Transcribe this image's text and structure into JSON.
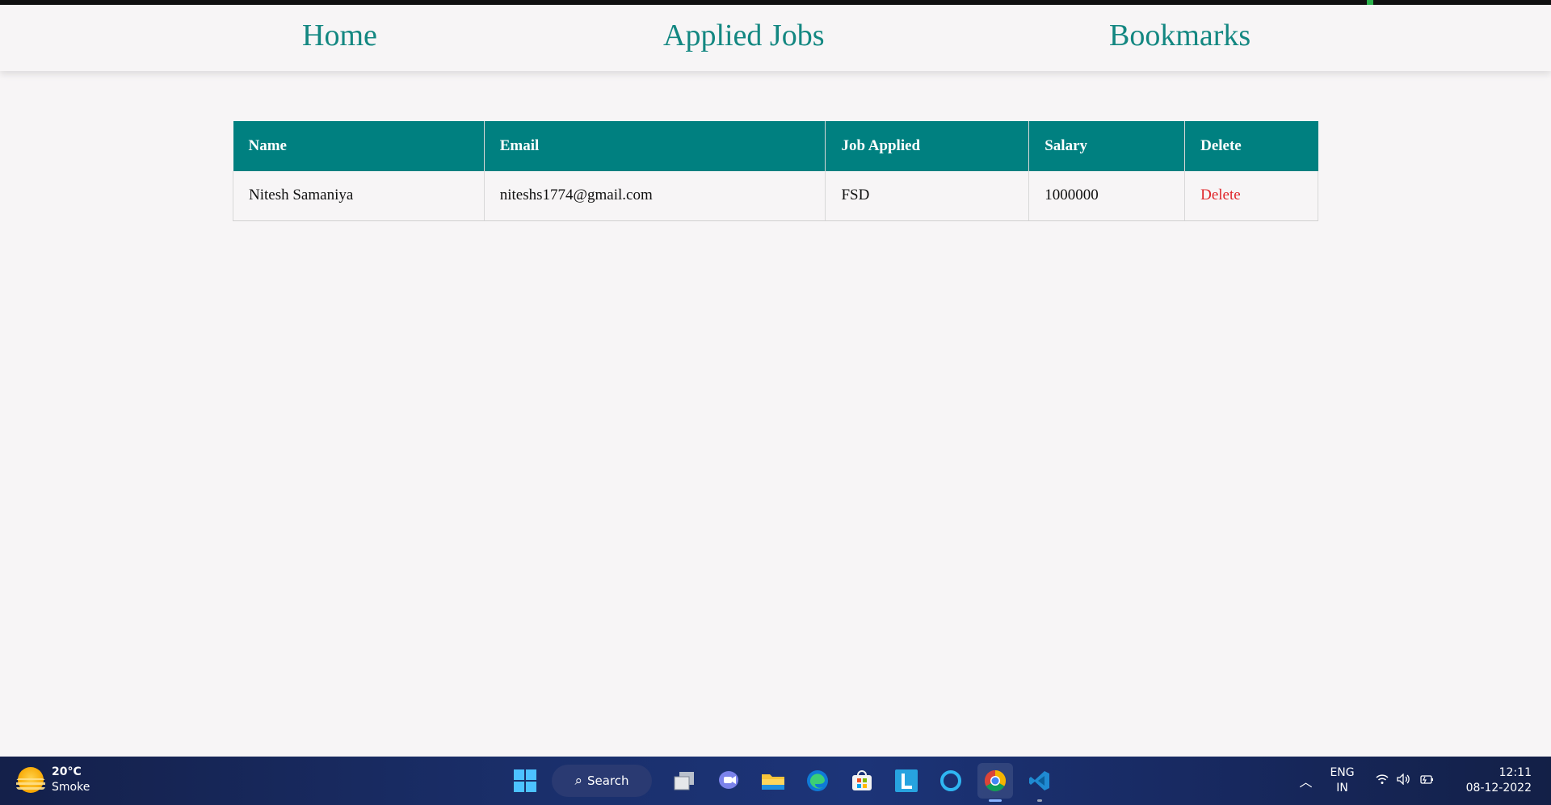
{
  "nav": {
    "home": "Home",
    "applied_jobs": "Applied Jobs",
    "bookmarks": "Bookmarks"
  },
  "table": {
    "headers": [
      "Name",
      "Email",
      "Job Applied",
      "Salary",
      "Delete"
    ],
    "rows": [
      {
        "name": "Nitesh Samaniya",
        "email": "niteshs1774@gmail.com",
        "job": "FSD",
        "salary": "1000000",
        "delete": "Delete"
      }
    ]
  },
  "colors": {
    "accent": "#008080",
    "nav_link": "#138781",
    "delete": "#e0262b"
  },
  "taskbar": {
    "weather_temp": "20°C",
    "weather_desc": "Smoke",
    "search_label": "Search",
    "lang_line1": "ENG",
    "lang_line2": "IN",
    "time": "12:11",
    "date": "08-12-2022",
    "icons": [
      "windows-start-icon",
      "search-icon",
      "task-view-icon",
      "teams-chat-icon",
      "file-explorer-icon",
      "edge-icon",
      "store-icon",
      "l-app-icon",
      "cortana-icon",
      "chrome-icon",
      "vscode-icon"
    ]
  }
}
